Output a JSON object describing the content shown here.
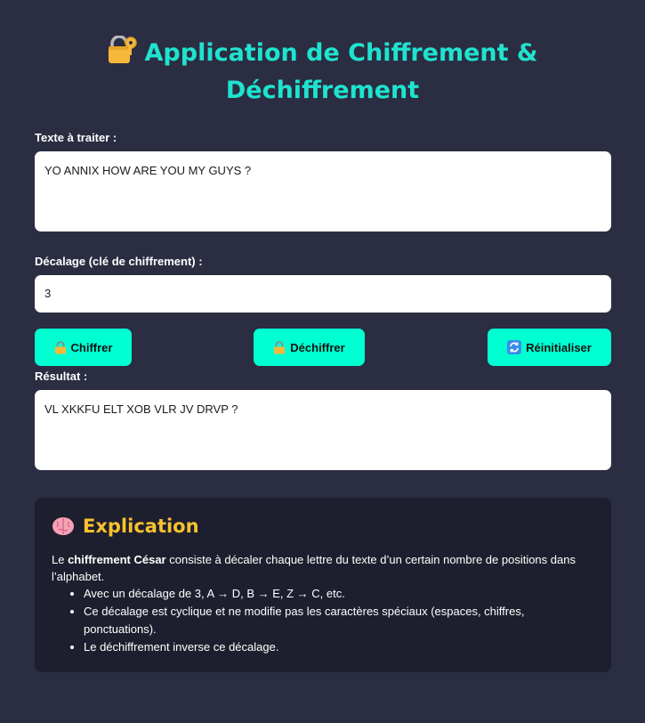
{
  "header": {
    "title": "Application de Chiffrement & Déchiffrement",
    "icon": "locked-with-key-icon"
  },
  "input": {
    "label": "Texte à traiter :",
    "value": "YO ANNIX HOW ARE YOU MY GUYS ?"
  },
  "shift": {
    "label": "Décalage (clé de chiffrement) :",
    "value": "3"
  },
  "buttons": {
    "encrypt": "Chiffrer",
    "decrypt": "Déchiffrer",
    "reset": "Réinitialiser"
  },
  "result": {
    "label": "Résultat :",
    "value": "VL XKKFU ELT XOB VLR JV DRVP ?"
  },
  "explanation": {
    "title": "Explication",
    "intro_prefix": "Le ",
    "intro_bold": "chiffrement César",
    "intro_suffix": " consiste à décaler chaque lettre du texte d’un certain nombre de positions dans l’alphabet.",
    "bullets": [
      "Avec un décalage de 3, A → D, B → E, Z → C, etc.",
      "Ce décalage est cyclique et ne modifie pas les caractères spéciaux (espaces, chiffres, ponctuations).",
      "Le déchiffrement inverse ce décalage."
    ]
  },
  "colors": {
    "background": "#2b2d42",
    "accent": "#1ee3cf",
    "button": "#00ffd1",
    "panel": "#1e1f2e",
    "panel_title": "#f9c22e"
  }
}
